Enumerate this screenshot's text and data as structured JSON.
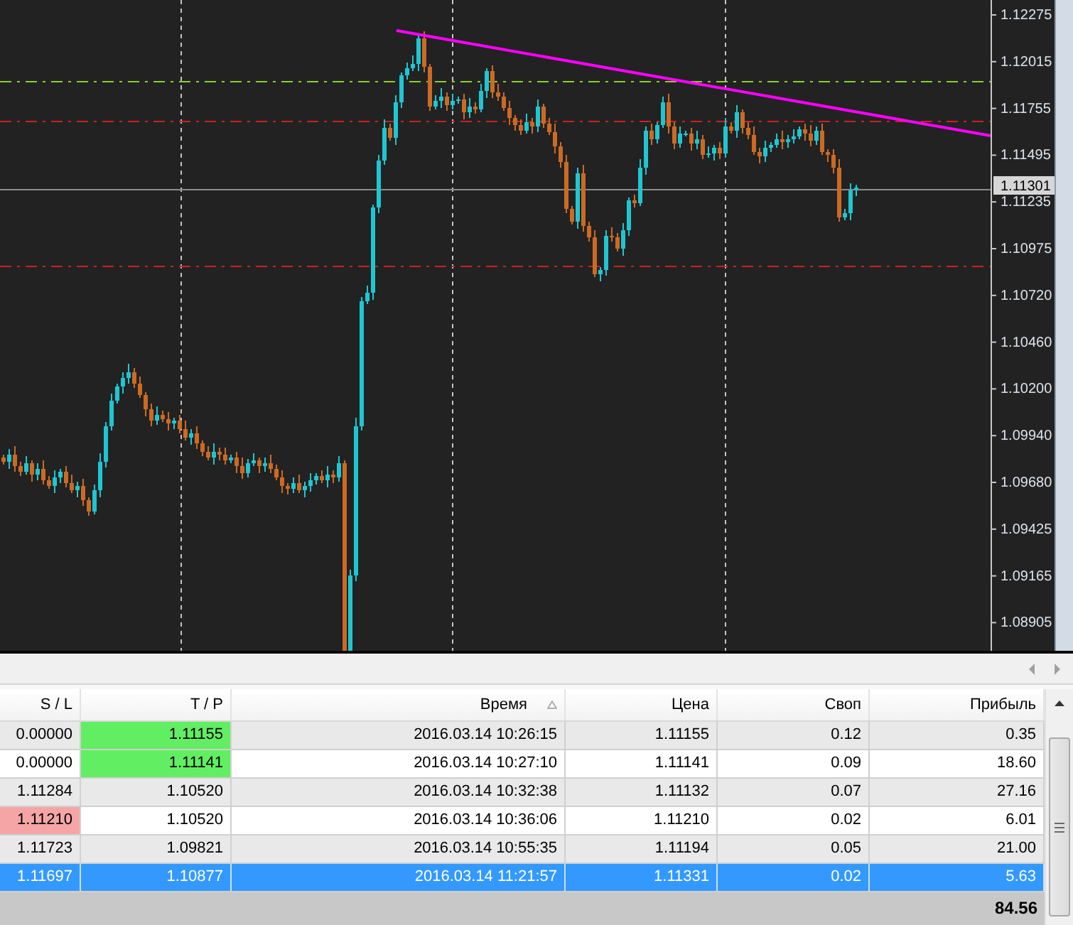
{
  "chart": {
    "price_axis": {
      "ticks": [
        "1.12275",
        "1.12015",
        "1.11755",
        "1.11495",
        "1.11235",
        "1.10975",
        "1.10720",
        "1.10460",
        "1.10200",
        "1.09940",
        "1.09680",
        "1.09425",
        "1.09165",
        "1.08905"
      ],
      "current_price": "1.11301"
    }
  },
  "table": {
    "columns": [
      {
        "label": "S / L",
        "sorted": false
      },
      {
        "label": "T / P",
        "sorted": false
      },
      {
        "label": "Время",
        "sorted": true
      },
      {
        "label": "Цена",
        "sorted": false
      },
      {
        "label": "Своп",
        "sorted": false
      },
      {
        "label": "Прибыль",
        "sorted": false
      }
    ],
    "rows": [
      {
        "sl": "0.00000",
        "tp": "1.11155",
        "time": "2016.03.14 10:26:15",
        "price": "1.11155",
        "swap": "0.12",
        "profit": "0.35",
        "sl_highlighted": false,
        "tp_highlighted": true,
        "selected": false
      },
      {
        "sl": "0.00000",
        "tp": "1.11141",
        "time": "2016.03.14 10:27:10",
        "price": "1.11141",
        "swap": "0.09",
        "profit": "18.60",
        "sl_highlighted": false,
        "tp_highlighted": true,
        "selected": false
      },
      {
        "sl": "1.11284",
        "tp": "1.10520",
        "time": "2016.03.14 10:32:38",
        "price": "1.11132",
        "swap": "0.07",
        "profit": "27.16",
        "sl_highlighted": false,
        "tp_highlighted": false,
        "selected": false
      },
      {
        "sl": "1.11210",
        "tp": "1.10520",
        "time": "2016.03.14 10:36:06",
        "price": "1.11210",
        "swap": "0.02",
        "profit": "6.01",
        "sl_highlighted": true,
        "tp_highlighted": false,
        "selected": false
      },
      {
        "sl": "1.11723",
        "tp": "1.09821",
        "time": "2016.03.14 10:55:35",
        "price": "1.11194",
        "swap": "0.05",
        "profit": "21.00",
        "sl_highlighted": false,
        "tp_highlighted": false,
        "selected": false
      },
      {
        "sl": "1.11697",
        "tp": "1.10877",
        "time": "2016.03.14 11:21:57",
        "price": "1.11331",
        "swap": "0.02",
        "profit": "5.63",
        "sl_highlighted": false,
        "tp_highlighted": false,
        "selected": true
      }
    ],
    "total": "84.56"
  }
}
